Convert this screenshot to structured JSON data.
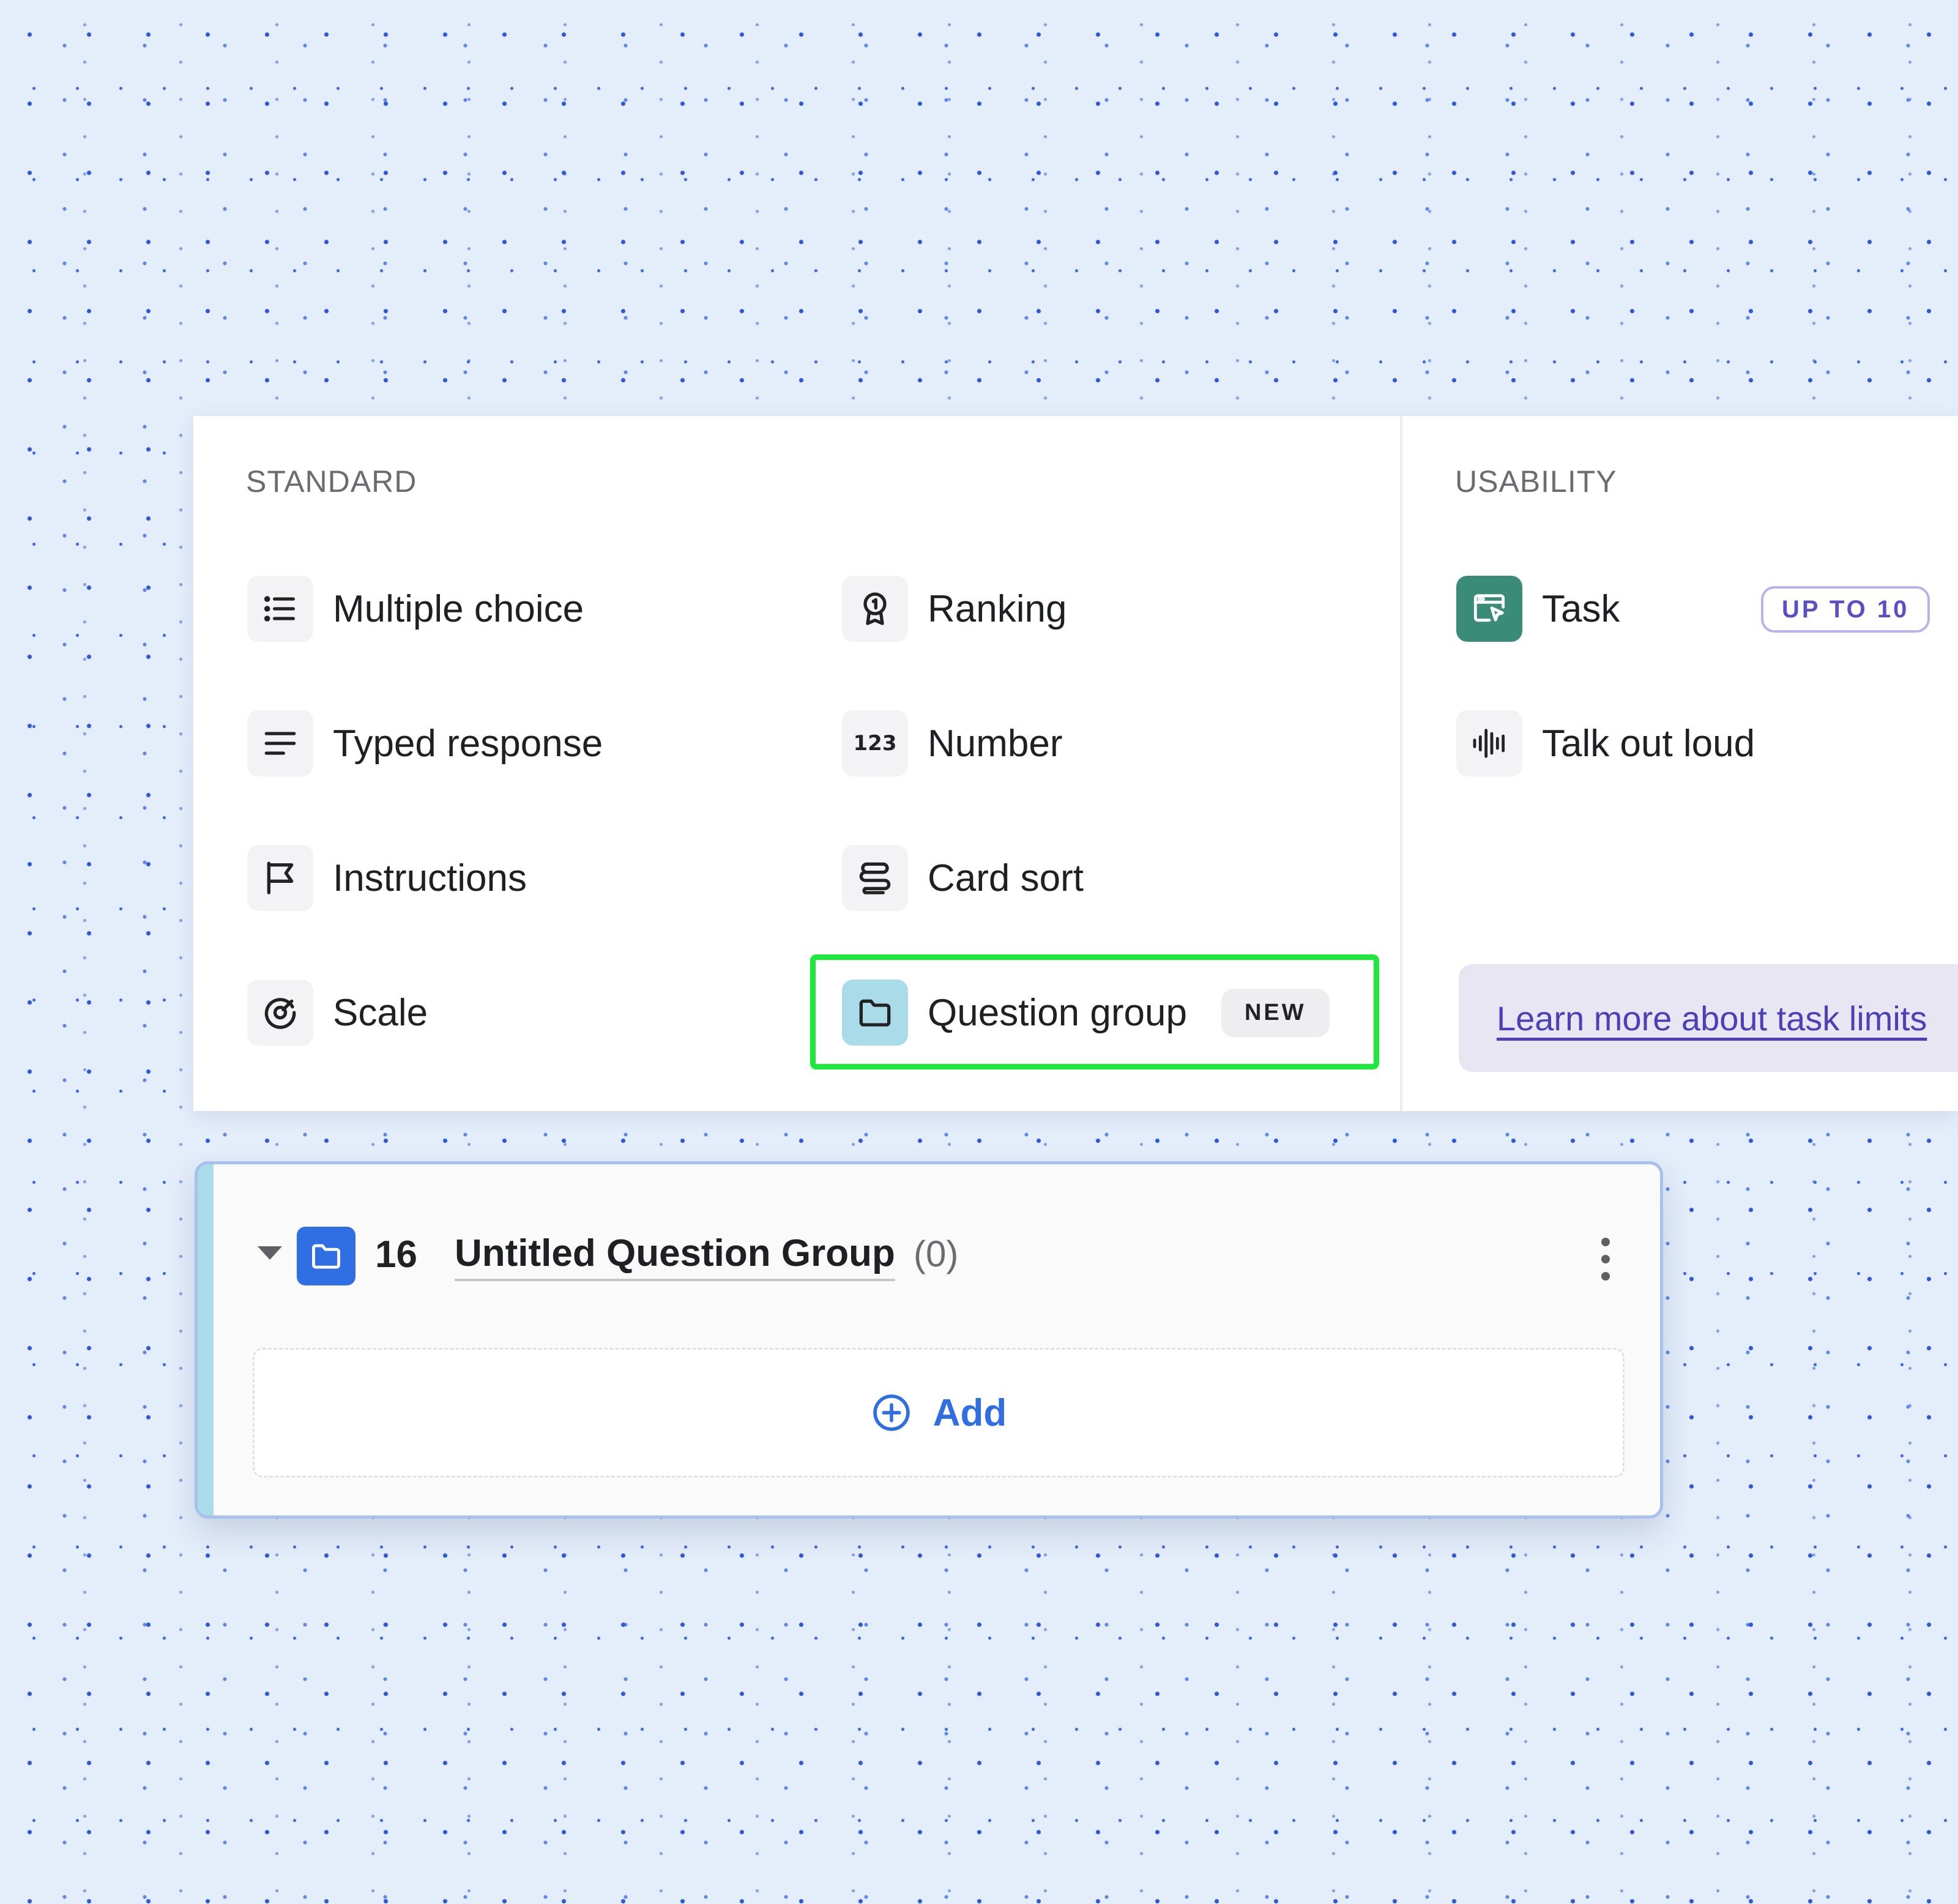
{
  "menu": {
    "standard": {
      "title": "STANDARD",
      "items": [
        {
          "label": "Multiple choice",
          "icon": "list-icon"
        },
        {
          "label": "Typed response",
          "icon": "text-lines-icon"
        },
        {
          "label": "Instructions",
          "icon": "flag-icon"
        },
        {
          "label": "Scale",
          "icon": "gauge-icon"
        },
        {
          "label": "Ranking",
          "icon": "ribbon-icon"
        },
        {
          "label": "Number",
          "icon": "number-icon",
          "glyph": "123"
        },
        {
          "label": "Card sort",
          "icon": "card-sort-icon"
        },
        {
          "label": "Question group",
          "icon": "folder-icon",
          "badge": "NEW"
        }
      ]
    },
    "usability": {
      "title": "USABILITY",
      "items": [
        {
          "label": "Task",
          "icon": "task-icon",
          "badge": "UP TO 10"
        },
        {
          "label": "Talk out loud",
          "icon": "audio-wave-icon"
        }
      ],
      "learn_more": "Learn more about task limits"
    }
  },
  "group": {
    "number": "16",
    "title": "Untitled Question Group",
    "count": "(0)",
    "add_label": "Add"
  },
  "colors": {
    "highlight": "#1ce93b",
    "accent_blue": "#2f6fe3",
    "task_green": "#3a8b78",
    "group_accent": "#a9dbe8",
    "badge_purple": "#5a4fc6"
  }
}
